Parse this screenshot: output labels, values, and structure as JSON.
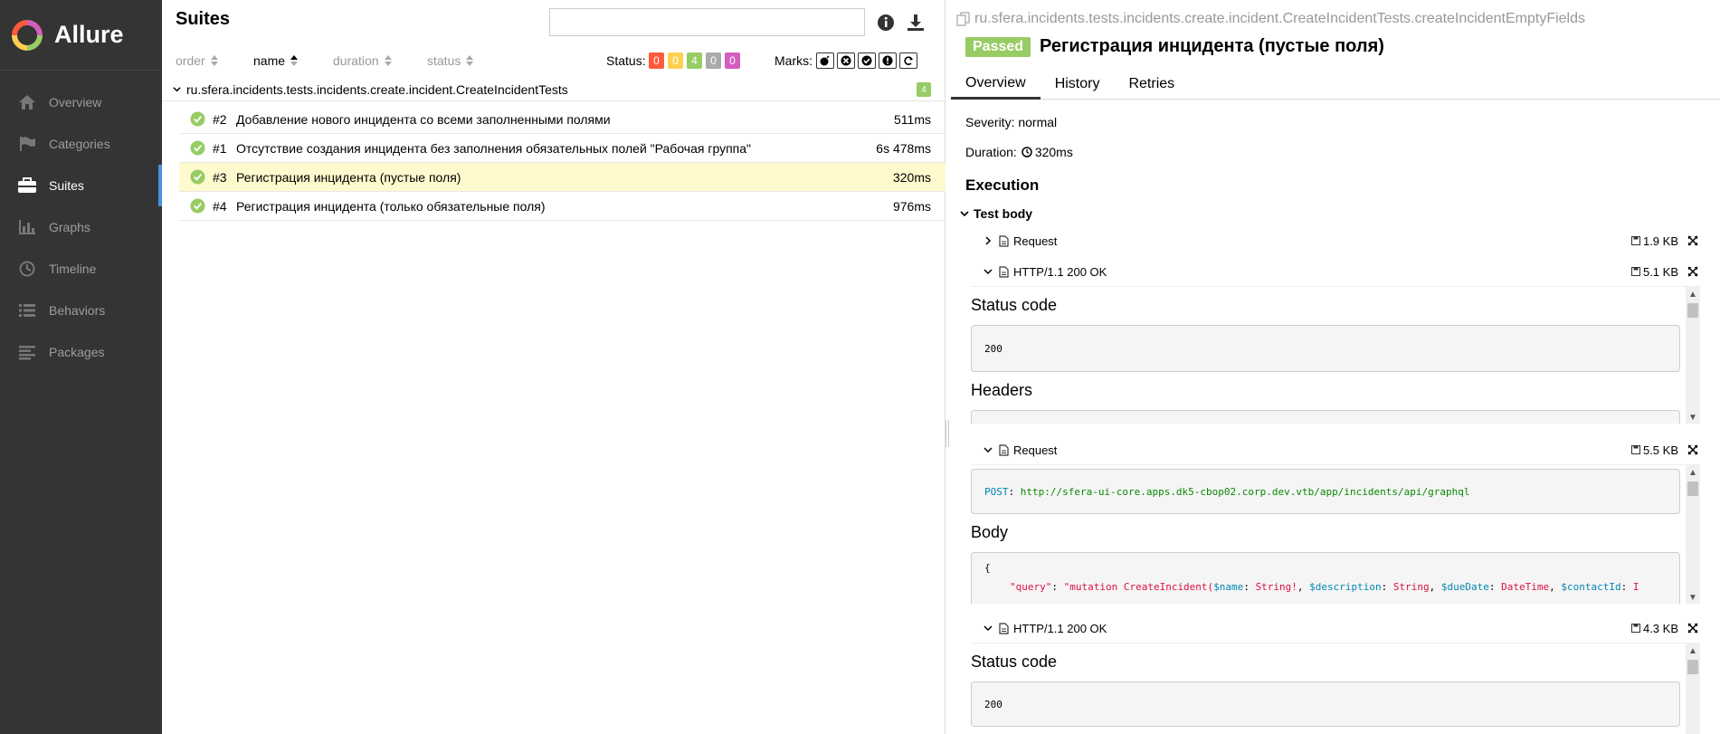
{
  "sidebar": {
    "brand": "Allure",
    "items": [
      {
        "label": "Overview",
        "icon": "home-icon"
      },
      {
        "label": "Categories",
        "icon": "flag-icon"
      },
      {
        "label": "Suites",
        "icon": "briefcase-icon",
        "active": true
      },
      {
        "label": "Graphs",
        "icon": "bar-chart-icon"
      },
      {
        "label": "Timeline",
        "icon": "clock-icon"
      },
      {
        "label": "Behaviors",
        "icon": "list-icon"
      },
      {
        "label": "Packages",
        "icon": "align-left-icon"
      }
    ]
  },
  "suites": {
    "title": "Suites",
    "search_value": "",
    "sort": {
      "order": "order",
      "name": "name",
      "duration": "duration",
      "status": "status"
    },
    "status_label": "Status:",
    "status_counts": [
      {
        "value": "0",
        "color": "#fd5a3e"
      },
      {
        "value": "0",
        "color": "#ffd050"
      },
      {
        "value": "4",
        "color": "#97cc64"
      },
      {
        "value": "0",
        "color": "#aaaaaa"
      },
      {
        "value": "0",
        "color": "#d35ebe"
      }
    ],
    "marks_label": "Marks:",
    "group": {
      "name": "ru.sfera.incidents.tests.incidents.create.incident.CreateIncidentTests",
      "count": "4"
    },
    "rows": [
      {
        "num": "#2",
        "name": "Добавление нового инцидента со всеми заполненными полями",
        "duration": "511ms"
      },
      {
        "num": "#1",
        "name": "Отсутствие создания инцидента без заполнения обязательных полей \"Рабочая группа\"",
        "duration": "6s 478ms"
      },
      {
        "num": "#3",
        "name": "Регистрация инцидента (пустые поля)",
        "duration": "320ms",
        "selected": true
      },
      {
        "num": "#4",
        "name": "Регистрация инцидента (только обязательные поля)",
        "duration": "976ms"
      }
    ]
  },
  "detail": {
    "breadcrumb": "ru.sfera.incidents.tests.incidents.create.incident.CreateIncidentTests.createIncidentEmptyFields",
    "status": "Passed",
    "title": "Регистрация инцидента (пустые поля)",
    "tabs": [
      "Overview",
      "History",
      "Retries"
    ],
    "severity": "Severity: normal",
    "duration_label": "Duration:",
    "duration_value": "320ms",
    "execution": "Execution",
    "test_body": "Test body",
    "attachments": [
      {
        "name": "Request",
        "size": "1.9 KB",
        "expanded": false
      },
      {
        "name": "HTTP/1.1 200 OK",
        "size": "5.1 KB",
        "expanded": true
      },
      {
        "name": "Request",
        "size": "5.5 KB",
        "expanded": true
      },
      {
        "name": "HTTP/1.1 200 OK",
        "size": "4.3 KB",
        "expanded": true
      }
    ],
    "resp1": {
      "status_heading": "Status code",
      "status_code": "200",
      "headers_heading": "Headers"
    },
    "req2": {
      "method": "POST",
      "url": "http://sfera-ui-core.apps.dk5-cbop02.corp.dev.vtb/app/incidents/api/graphql",
      "body_heading": "Body",
      "brace": "{",
      "key": "\"query\"",
      "val1": "\"mutation CreateIncident(",
      "p1": "$name",
      "t1": "String!",
      "p2": "$description",
      "t2": "String",
      "p3": "$dueDate",
      "t3": "DateTime",
      "p4": "$contactId",
      "t4": "I"
    },
    "resp2": {
      "status_heading": "Status code",
      "status_code": "200"
    }
  }
}
